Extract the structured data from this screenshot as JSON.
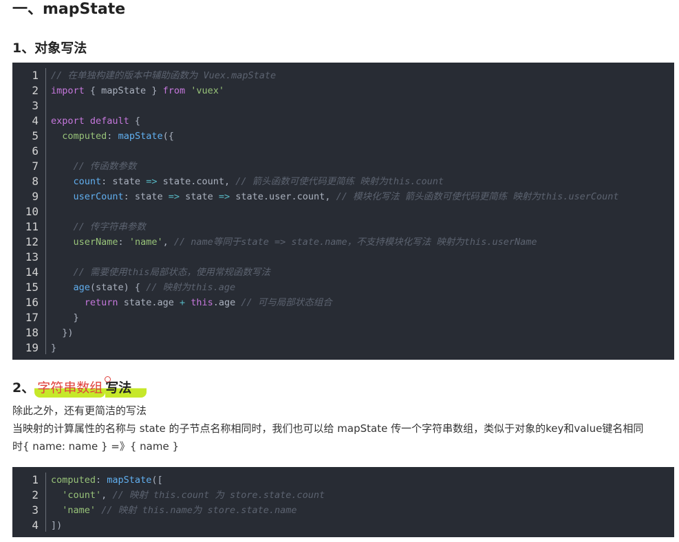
{
  "title": "一、mapState",
  "section1": {
    "heading": "1、对象写法"
  },
  "code1": {
    "lines": [
      "<span class=\"c\">// 在单独构建的版本中辅助函数为 Vuex.mapState</span>",
      "<span class=\"k\">import</span> { mapState } <span class=\"k\">from</span> <span class=\"s\">'vuex'</span>",
      "",
      "<span class=\"k\">export default</span> {",
      "  <span class=\"p\">computed</span>: <span class=\"f\">mapState</span>({",
      "",
      "    <span class=\"c\">// 传函数参数</span>",
      "    <span class=\"f\">count</span>: state <span class=\"o\">=></span> state.count, <span class=\"c\">// 箭头函数可使代码更简练 映射为this.count</span>",
      "    <span class=\"f\">userCount</span>: state <span class=\"o\">=></span> state <span class=\"o\">=></span> state.user.count, <span class=\"c\">// 模块化写法 箭头函数可使代码更简练 映射为this.userCount</span>",
      "",
      "    <span class=\"c\">// 传字符串参数</span>",
      "    <span class=\"p\">userName</span>: <span class=\"s\">'name'</span>, <span class=\"c\">// name等同于state => state.name，不支持模块化写法 映射为this.userName</span>",
      "",
      "    <span class=\"c\">// 需要使用this局部状态，使用常规函数写法</span>",
      "    <span class=\"f\">age</span>(state) { <span class=\"c\">// 映射为this.age</span>",
      "      <span class=\"k\">return</span> state.age <span class=\"o\">+</span> <span class=\"k\">this</span>.age <span class=\"c\">// 可与局部状态组合</span>",
      "    }",
      "  })",
      "}"
    ]
  },
  "section2": {
    "prefix": "2、",
    "highlight": "字符串数组",
    "suffix": "写法"
  },
  "paragraph1": "除此之外，还有更简洁的写法",
  "paragraph2": "当映射的计算属性的名称与 state 的子节点名称相同时，我们也可以给 mapState 传一个字符串数组，类似于对象的key和value键名相同",
  "paragraph3": "时{ name: name } =》{ name }",
  "code2": {
    "lines": [
      "<span class=\"p\">computed</span>: <span class=\"f\">mapState</span>([",
      "  <span class=\"s\">'count'</span>, <span class=\"c\">// 映射 this.count 为 store.state.count</span>",
      "  <span class=\"s\">'name'</span> <span class=\"c\">// 映射 this.name为 store.state.name</span>",
      "])"
    ]
  }
}
